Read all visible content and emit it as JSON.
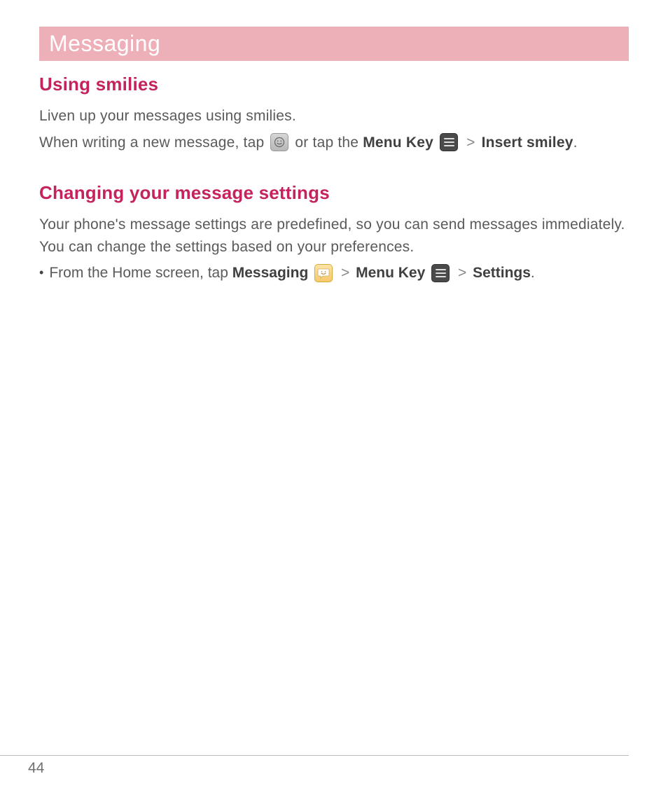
{
  "header": {
    "title": "Messaging"
  },
  "section1": {
    "heading": "Using smilies",
    "intro": "Liven up your messages using smilies.",
    "line_part1": "When writing a new message, tap ",
    "line_part2": " or tap the ",
    "menu_key": "Menu Key",
    "sep": ">",
    "insert_smiley": "Insert smiley",
    "period": "."
  },
  "section2": {
    "heading": "Changing your message settings",
    "intro": "Your phone's message settings are predefined, so you can send messages immediately. You can change the settings based on your preferences.",
    "bullet_part1": "From the Home screen, tap ",
    "messaging": "Messaging",
    "sep": ">",
    "menu_key": "Menu Key",
    "settings": "Settings",
    "period": "."
  },
  "footer": {
    "page_number": "44"
  }
}
